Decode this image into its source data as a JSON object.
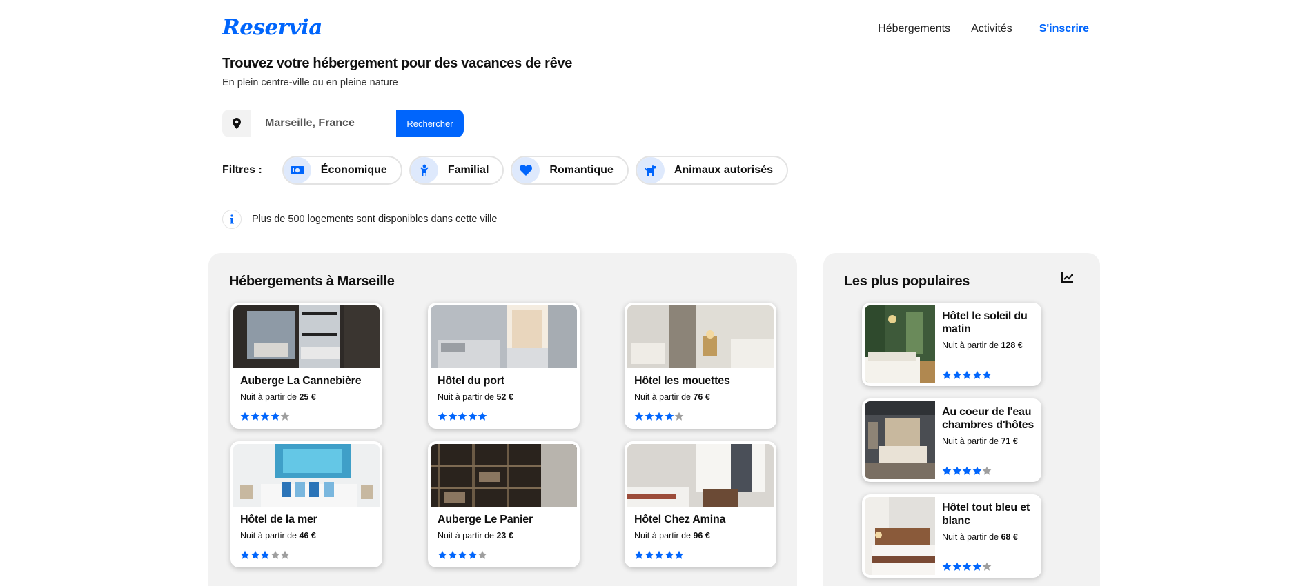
{
  "brand": {
    "name": "Reservia",
    "accent": "#0065fc"
  },
  "nav": {
    "items": [
      "Hébergements",
      "Activités"
    ],
    "signup": "S'inscrire"
  },
  "hero": {
    "title": "Trouvez votre hébergement pour des vacances de rêve",
    "subtitle": "En plein centre-ville ou en pleine nature"
  },
  "search": {
    "value": "Marseille, France",
    "button": "Rechercher",
    "icon": "map-pin-icon"
  },
  "filters": {
    "label": "Filtres :",
    "items": [
      {
        "label": "Économique",
        "icon": "money-icon"
      },
      {
        "label": "Familial",
        "icon": "child-icon"
      },
      {
        "label": "Romantique",
        "icon": "heart-icon"
      },
      {
        "label": "Animaux autorisés",
        "icon": "dog-icon"
      }
    ]
  },
  "info": {
    "text": "Plus de 500 logements sont disponibles dans cette ville",
    "icon": "info-icon"
  },
  "listings": {
    "title": "Hébergements à Marseille",
    "price_prefix": "Nuit à partir de ",
    "items": [
      {
        "name": "Auberge La Cannebière",
        "price": "25 €",
        "rating": 4
      },
      {
        "name": "Hôtel du port",
        "price": "52 €",
        "rating": 5
      },
      {
        "name": "Hôtel les mouettes",
        "price": "76 €",
        "rating": 4
      },
      {
        "name": "Hôtel de la mer",
        "price": "46 €",
        "rating": 3
      },
      {
        "name": "Auberge Le Panier",
        "price": "23 €",
        "rating": 4
      },
      {
        "name": "Hôtel Chez Amina",
        "price": "96 €",
        "rating": 5
      }
    ]
  },
  "popular": {
    "title": "Les plus populaires",
    "icon": "chart-trend-icon",
    "price_prefix": "Nuit à partir de ",
    "items": [
      {
        "name": "Hôtel le soleil du matin",
        "price": "128 €",
        "rating": 5
      },
      {
        "name": "Au coeur de l'eau chambres d'hôtes",
        "price": "71 €",
        "rating": 4
      },
      {
        "name": "Hôtel tout bleu et blanc",
        "price": "68 €",
        "rating": 4
      }
    ]
  }
}
